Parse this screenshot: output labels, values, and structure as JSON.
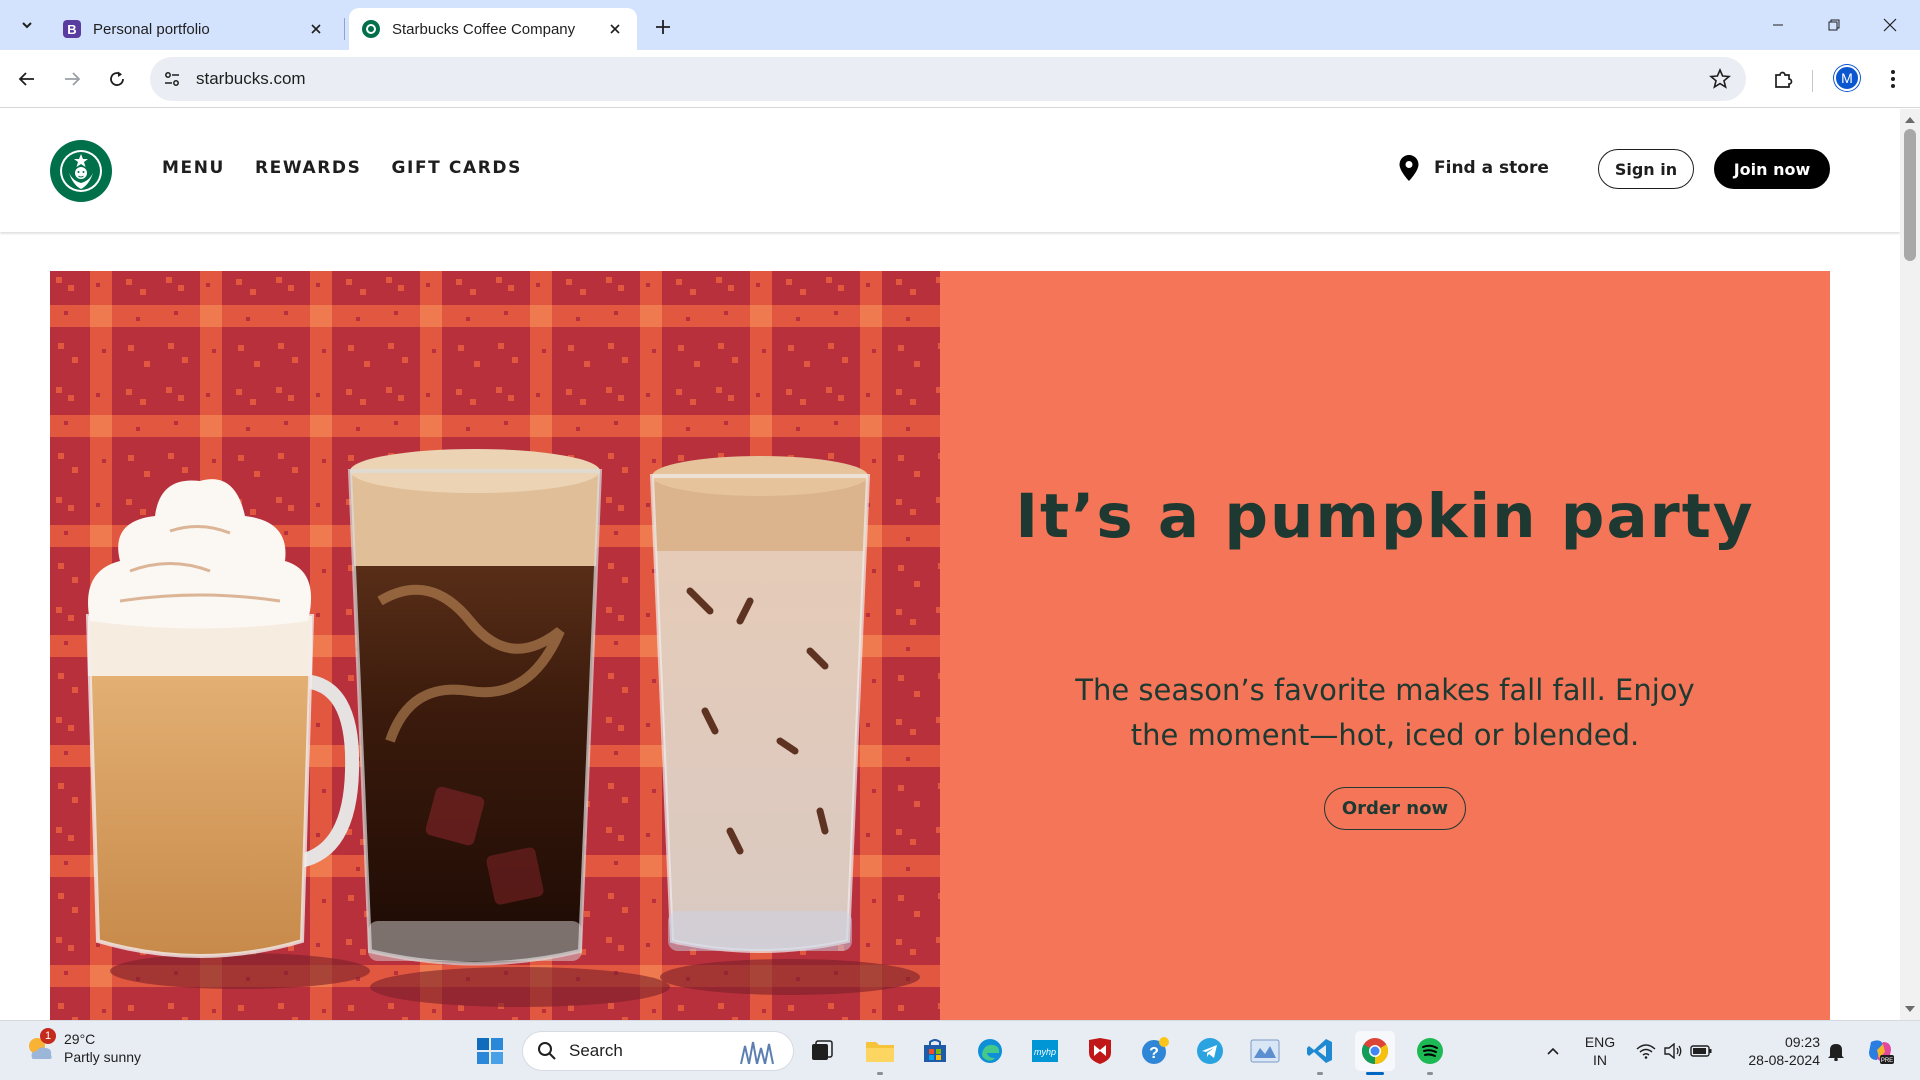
{
  "browser": {
    "tabs": [
      {
        "title": "Personal portfolio",
        "favicon": "bootstrap-icon",
        "active": false
      },
      {
        "title": "Starbucks Coffee Company",
        "favicon": "starbucks-icon",
        "active": true
      }
    ],
    "address": "starbucks.com",
    "profile_initial": "M"
  },
  "header": {
    "nav": [
      "MENU",
      "REWARDS",
      "GIFT CARDS"
    ],
    "find_store": "Find a store",
    "sign_in": "Sign in",
    "join_now": "Join now"
  },
  "hero": {
    "title": "It’s a pumpkin party",
    "subtitle": "The season’s favorite makes fall fall. Enjoy the moment—hot, iced or blended.",
    "cta": "Order now",
    "colors": {
      "panel": "#f47557",
      "text": "#1e3932",
      "pattern": "#b8303c"
    }
  },
  "taskbar": {
    "weather_temp": "29°C",
    "weather_desc": "Partly sunny",
    "weather_badge": "1",
    "search_label": "Search",
    "lang_line1": "ENG",
    "lang_line2": "IN",
    "time": "09:23",
    "date": "28-08-2024"
  }
}
